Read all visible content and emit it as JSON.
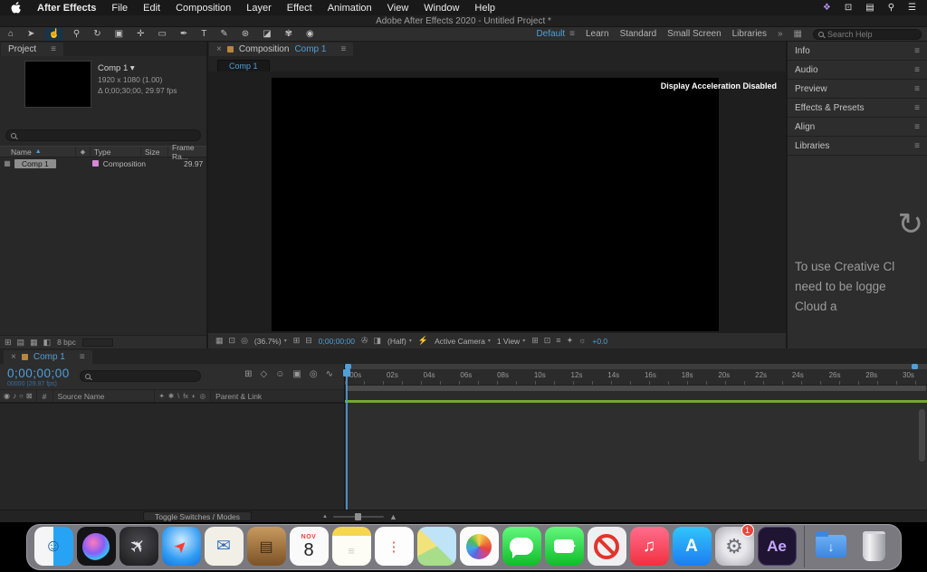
{
  "colors": {
    "accent_blue": "#4f9fd8",
    "render_bar_green": "#74a82e",
    "selection_gray": "#8e8e8e",
    "badge_red": "#e8463c"
  },
  "menu_bar": {
    "menus": [
      "After Effects",
      "File",
      "Edit",
      "Composition",
      "Layer",
      "Effect",
      "Animation",
      "View",
      "Window",
      "Help"
    ],
    "status_icons": [
      {
        "name": "menubar-chat-icon",
        "glyph": "❖"
      },
      {
        "name": "menubar-display-icon",
        "glyph": "⊡"
      },
      {
        "name": "menubar-airplay-icon",
        "glyph": "▤"
      },
      {
        "name": "menubar-search-icon",
        "glyph": "⚲"
      },
      {
        "name": "menubar-notification-center-icon",
        "glyph": "☰"
      }
    ]
  },
  "title_bar": {
    "title": "Adobe After Effects 2020 - Untitled Project *"
  },
  "toolbar": {
    "tools": [
      {
        "name": "home-tool",
        "glyph": "⌂"
      },
      {
        "name": "selection-tool",
        "glyph": "➤"
      },
      {
        "name": "hand-tool",
        "glyph": "☝",
        "active": true
      },
      {
        "name": "zoom-tool",
        "glyph": "⚲"
      },
      {
        "name": "orbit-camera-tool",
        "glyph": "↻"
      },
      {
        "name": "camera-tool",
        "glyph": "▣"
      },
      {
        "name": "pan-behind-tool",
        "glyph": "✛"
      },
      {
        "name": "rectangle-tool",
        "glyph": "▭"
      },
      {
        "name": "pen-tool",
        "glyph": "✒"
      },
      {
        "name": "type-tool",
        "glyph": "T"
      },
      {
        "name": "brush-tool",
        "glyph": "✎"
      },
      {
        "name": "clone-stamp-tool",
        "glyph": "⊛"
      },
      {
        "name": "eraser-tool",
        "glyph": "◪"
      },
      {
        "name": "roto-brush-tool",
        "glyph": "✾"
      },
      {
        "name": "puppet-pin-tool",
        "glyph": "◉"
      }
    ],
    "workspace": {
      "selected": "Default",
      "flyout": "≡",
      "items": [
        "Learn",
        "Standard",
        "Small Screen",
        "Libraries"
      ],
      "overflow": "»",
      "grid_icon": "▦"
    },
    "search": {
      "placeholder": "Search Help"
    }
  },
  "project_panel": {
    "tab": "Project",
    "flyout": "≡",
    "preview": {
      "title": "Comp 1 ▾",
      "dims": "1920 x 1080 (1.00)",
      "time": "Δ 0;00;30;00, 29.97 fps"
    },
    "columns": {
      "name": "Name",
      "sort_arrow": "▲",
      "label_icon": "◆",
      "type": "Type",
      "size": "Size",
      "frame_rate": "Frame Ra..."
    },
    "row": {
      "icon": "▦",
      "name": "Comp 1",
      "type": "Composition",
      "frame_rate": "29.97"
    },
    "footer": {
      "icons": [
        {
          "name": "interpret-footage-icon",
          "glyph": "⊞"
        },
        {
          "name": "new-folder-icon",
          "glyph": "▤"
        },
        {
          "name": "new-composition-icon",
          "glyph": "▦"
        },
        {
          "name": "color-depth-icon",
          "glyph": "◧"
        }
      ],
      "bpc": "8 bpc"
    }
  },
  "comp_panel": {
    "tab": {
      "close": "×",
      "prefix": "Composition",
      "comp": "Comp 1",
      "flyout": "≡"
    },
    "viewer_tab": "Comp 1",
    "overlay": "Display Acceleration Disabled",
    "footer": {
      "icons_a": [
        {
          "name": "transparency-grid-icon",
          "glyph": "▦"
        },
        {
          "name": "monitor-icon",
          "glyph": "⊡"
        },
        {
          "name": "mask-paths-icon",
          "glyph": "◎"
        }
      ],
      "magnification": "(36.7%)",
      "caret": "▾",
      "icons_b": [
        {
          "name": "grid-guides-icon",
          "glyph": "⊞"
        },
        {
          "name": "region-of-interest-icon",
          "glyph": "⊟"
        }
      ],
      "timecode": "0;00;00;00",
      "icons_c": [
        {
          "name": "snapshot-icon",
          "glyph": "✇"
        },
        {
          "name": "show-snapshot-icon",
          "glyph": "◨"
        }
      ],
      "resolution": "(Half)",
      "icons_d": [
        {
          "name": "fast-previews-icon",
          "glyph": "⚡"
        }
      ],
      "camera": "Active Camera",
      "view_layout": "1 View",
      "icons_e": [
        {
          "name": "share-view-icon",
          "glyph": "⊞"
        },
        {
          "name": "pixel-aspect-icon",
          "glyph": "⊡"
        },
        {
          "name": "timeline-button-icon",
          "glyph": "≡"
        },
        {
          "name": "flowchart-button-icon",
          "glyph": "✦"
        },
        {
          "name": "exposure-gear-icon",
          "glyph": "☼"
        }
      ],
      "exposure": "+0.0"
    }
  },
  "right_stack": {
    "panels": [
      {
        "label": "Info",
        "name": "panel-tab-info",
        "flyout": "≡"
      },
      {
        "label": "Audio",
        "name": "panel-tab-audio",
        "flyout": "≡"
      },
      {
        "label": "Preview",
        "name": "panel-tab-preview",
        "flyout": "≡"
      },
      {
        "label": "Effects & Presets",
        "name": "panel-tab-effects-presets",
        "flyout": "≡"
      },
      {
        "label": "Align",
        "name": "panel-tab-align",
        "flyout": "≡"
      },
      {
        "label": "Libraries",
        "name": "panel-tab-libraries",
        "flyout": "≡"
      }
    ],
    "libraries": {
      "icon_glyph": "↻",
      "message_lines": [
        "To use Creative Cl",
        "need to be logge",
        "Cloud a"
      ]
    }
  },
  "timeline": {
    "tab": {
      "close": "×",
      "comp": "Comp 1",
      "flyout": "≡"
    },
    "timecode": "0;00;00;00",
    "frame_info": "00000 (29.97 fps)",
    "left_icons": [
      {
        "name": "comp-mini-flowchart-icon",
        "glyph": "⊞"
      },
      {
        "name": "draft-3d-icon",
        "glyph": "◇"
      },
      {
        "name": "shy-layers-icon",
        "glyph": "☺"
      },
      {
        "name": "frame-blending-icon",
        "glyph": "▣"
      },
      {
        "name": "motion-blur-icon",
        "glyph": "◎"
      },
      {
        "name": "graph-editor-icon",
        "glyph": "∿"
      }
    ],
    "header": {
      "av_icons": [
        {
          "name": "video-eye-icon",
          "glyph": "◉"
        },
        {
          "name": "audio-icon",
          "glyph": "♪"
        },
        {
          "name": "solo-icon",
          "glyph": "○"
        },
        {
          "name": "lock-icon",
          "glyph": "⊠"
        }
      ],
      "hash": "#",
      "source_name": "Source Name",
      "switch_icons": [
        {
          "name": "quality-icon",
          "glyph": "✦"
        },
        {
          "name": "collapse-transformations-icon",
          "glyph": "✱"
        },
        {
          "name": "frame-blend-switch-icon",
          "glyph": "\\"
        },
        {
          "name": "effects-fx-icon",
          "glyph": "fx"
        },
        {
          "name": "adjustment-layer-icon",
          "glyph": "◐"
        },
        {
          "name": "three-d-layer-icon",
          "glyph": "◎"
        }
      ],
      "parent_link": "Parent & Link"
    },
    "ruler_labels": [
      ":00s",
      "02s",
      "04s",
      "06s",
      "08s",
      "10s",
      "12s",
      "14s",
      "16s",
      "18s",
      "20s",
      "22s",
      "24s",
      "26s",
      "28s",
      "30s"
    ],
    "toggle_button": "Toggle Switches / Modes",
    "zoom": {
      "out_icon": "▲",
      "in_icon": "▲"
    }
  },
  "dock": {
    "items": [
      {
        "id": "finder",
        "name": "finder",
        "glyph": "☺"
      },
      {
        "id": "siri",
        "name": "siri",
        "glyph": ""
      },
      {
        "id": "launchpad",
        "name": "launchpad",
        "glyph": "✈"
      },
      {
        "id": "safari",
        "name": "safari",
        "glyph": "➤"
      },
      {
        "id": "mail",
        "name": "mail",
        "glyph": "✉"
      },
      {
        "id": "contacts",
        "name": "contacts",
        "glyph": "▤"
      },
      {
        "id": "calendar",
        "name": "calendar",
        "sub": "NOV",
        "glyph": "8"
      },
      {
        "id": "notes",
        "name": "notes",
        "glyph": "≡"
      },
      {
        "id": "reminders",
        "name": "reminders",
        "glyph": "⋮"
      },
      {
        "id": "maps",
        "name": "maps",
        "glyph": ""
      },
      {
        "id": "photos",
        "name": "photos",
        "glyph": ""
      },
      {
        "id": "messages",
        "name": "messages",
        "glyph": ""
      },
      {
        "id": "facetime",
        "name": "facetime",
        "glyph": ""
      },
      {
        "id": "blocked",
        "name": "blocked-app",
        "glyph": ""
      },
      {
        "id": "music",
        "name": "music",
        "glyph": "♫"
      },
      {
        "id": "appstore",
        "name": "app-store",
        "glyph": "A"
      },
      {
        "id": "sysprefs",
        "name": "system-preferences",
        "glyph": "⚙",
        "badge": "1"
      },
      {
        "id": "ae",
        "name": "after-effects",
        "glyph": "Ae"
      },
      {
        "id": "sep",
        "name": "dock-separator",
        "glyph": ""
      },
      {
        "id": "downloads",
        "name": "downloads-folder",
        "glyph": "↓"
      },
      {
        "id": "trash",
        "name": "trash",
        "glyph": ""
      }
    ]
  }
}
